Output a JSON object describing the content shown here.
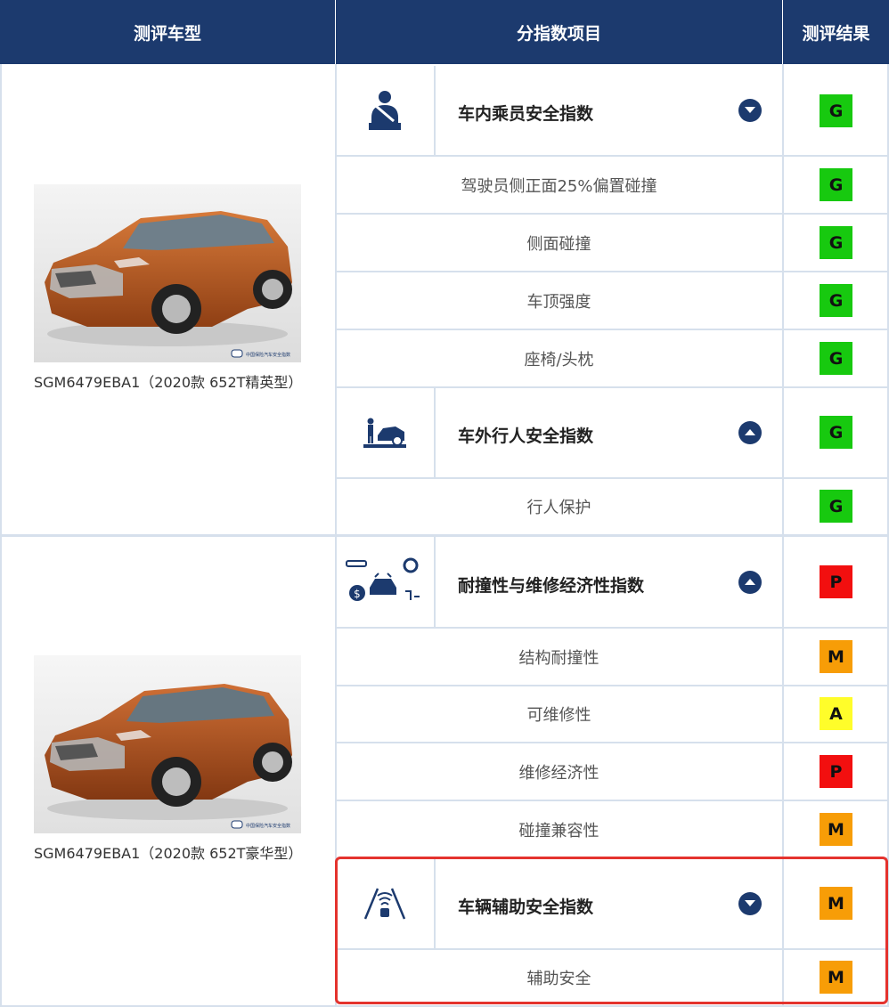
{
  "header": {
    "model": "测评车型",
    "item": "分指数项目",
    "result": "测评结果"
  },
  "cars": [
    {
      "name": "SGM6479EBA1（2020款 652T精英型）",
      "watermark": "中国保险汽车安全指数"
    },
    {
      "name": "SGM6479EBA1（2020款 652T豪华型）",
      "watermark": "中国保险汽车安全指数"
    }
  ],
  "categories": [
    {
      "label": "车内乘员安全指数",
      "icon": "seatbelt-occupant-icon",
      "expanded": true,
      "result": "G"
    },
    {
      "label": "车外行人安全指数",
      "icon": "pedestrian-car-icon",
      "expanded": false,
      "result": "G"
    },
    {
      "label": "耐撞性与维修经济性指数",
      "icon": "repair-economy-icon",
      "expanded": false,
      "result": "P"
    },
    {
      "label": "车辆辅助安全指数",
      "icon": "assist-lane-icon",
      "expanded": true,
      "result": "M"
    }
  ],
  "items": [
    {
      "label": "驾驶员侧正面25%偏置碰撞",
      "result": "G"
    },
    {
      "label": "侧面碰撞",
      "result": "G"
    },
    {
      "label": "车顶强度",
      "result": "G"
    },
    {
      "label": "座椅/头枕",
      "result": "G"
    },
    {
      "label": "行人保护",
      "result": "G"
    },
    {
      "label": "结构耐撞性",
      "result": "M"
    },
    {
      "label": "可维修性",
      "result": "A"
    },
    {
      "label": "维修经济性",
      "result": "P"
    },
    {
      "label": "碰撞兼容性",
      "result": "M"
    },
    {
      "label": "辅助安全",
      "result": "M"
    }
  ],
  "colors": {
    "header": "#1c3a6e",
    "G": "#17c90f",
    "P": "#f20f0f",
    "M": "#f79d07",
    "A": "#fffd2a",
    "highlight": "#e4332e"
  }
}
